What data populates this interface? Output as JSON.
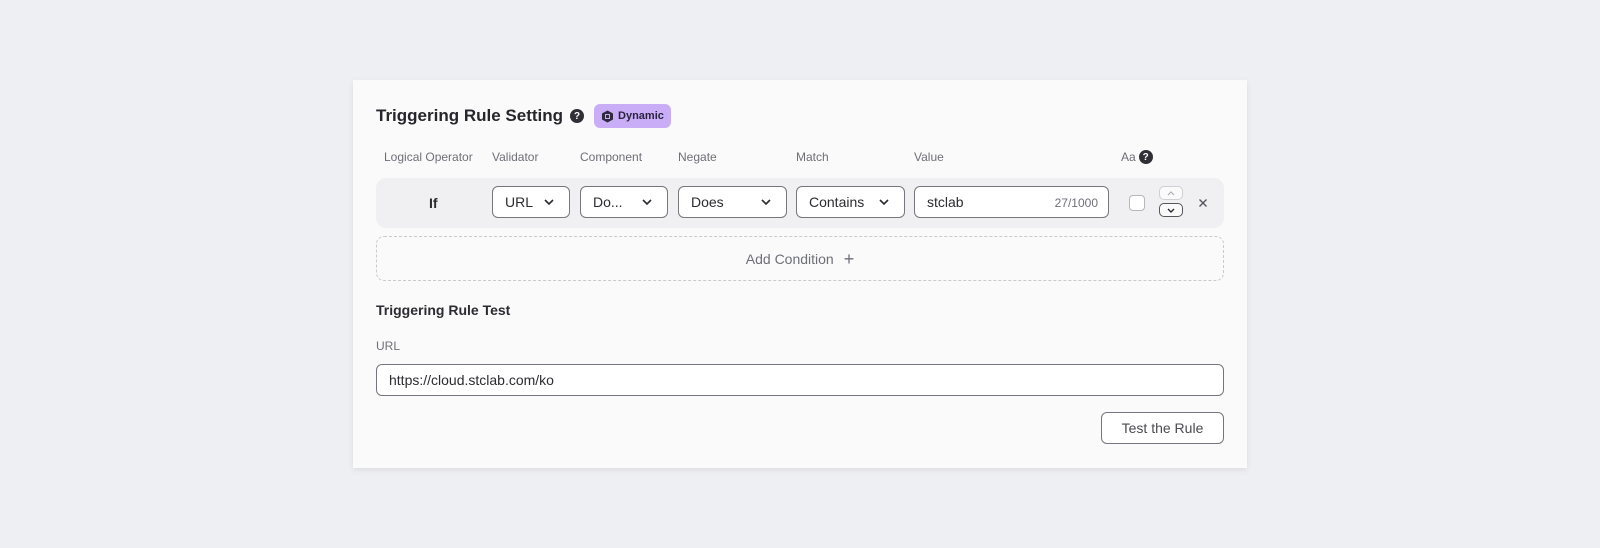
{
  "header": {
    "title": "Triggering Rule Setting",
    "help_icon": "question-circle-icon",
    "badge": {
      "label": "Dynamic",
      "icon": "hexagon-icon",
      "color": "#c9aef7"
    }
  },
  "columns": {
    "logical_operator": "Logical Operator",
    "validator": "Validator",
    "component": "Component",
    "negate": "Negate",
    "match": "Match",
    "value": "Value",
    "case_sensitive": "Aa"
  },
  "condition": {
    "operator": "If",
    "validator": "URL",
    "component": "Do...",
    "negate": "Does",
    "match": "Contains",
    "value": "stclab",
    "counter": "27/1000",
    "case_sensitive_checked": false
  },
  "add_condition": {
    "label": "Add Condition",
    "icon": "plus-icon"
  },
  "test": {
    "title": "Triggering Rule Test",
    "url_label": "URL",
    "url_value": "https://cloud.stclab.com/ko",
    "button_label": "Test the Rule"
  }
}
